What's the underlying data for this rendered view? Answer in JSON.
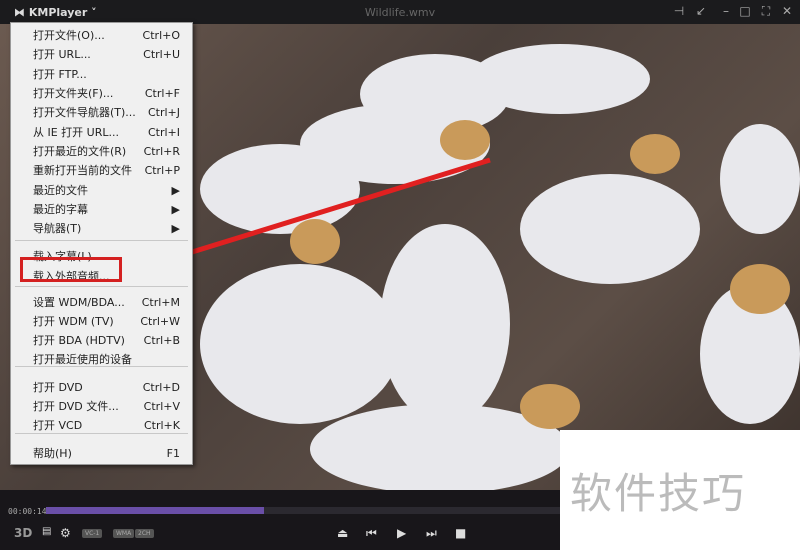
{
  "window": {
    "app": "KMPlayer",
    "title": "Wildlife.wmv",
    "buttons": [
      "pin",
      "shrink",
      "minimize",
      "maximize",
      "fullscreen",
      "close"
    ]
  },
  "menu": {
    "items": [
      {
        "label": "打开文件(O)...",
        "shortcut": "Ctrl+O"
      },
      {
        "label": "打开 URL...",
        "shortcut": "Ctrl+U"
      },
      {
        "label": "打开 FTP...",
        "shortcut": ""
      },
      {
        "label": "打开文件夹(F)...",
        "shortcut": "Ctrl+F"
      },
      {
        "label": "打开文件导航器(T)...",
        "shortcut": "Ctrl+J"
      },
      {
        "label": "从 IE 打开 URL...",
        "shortcut": "Ctrl+I"
      },
      {
        "label": "打开最近的文件(R)",
        "shortcut": "Ctrl+R"
      },
      {
        "label": "重新打开当前的文件",
        "shortcut": "Ctrl+P"
      },
      {
        "label": "最近的文件",
        "shortcut": "▶"
      },
      {
        "label": "最近的字幕",
        "shortcut": "▶"
      },
      {
        "label": "导航器(T)",
        "shortcut": "▶"
      },
      {
        "label": "载入字幕(L)...",
        "shortcut": ""
      },
      {
        "label": "载入外部音频...",
        "shortcut": ""
      },
      {
        "label": "设置 WDM/BDA...",
        "shortcut": "Ctrl+M"
      },
      {
        "label": "打开 WDM (TV)",
        "shortcut": "Ctrl+W"
      },
      {
        "label": "打开 BDA (HDTV)",
        "shortcut": "Ctrl+B"
      },
      {
        "label": "打开最近使用的设备",
        "shortcut": ""
      },
      {
        "label": "打开 DVD",
        "shortcut": "Ctrl+D"
      },
      {
        "label": "打开 DVD 文件...",
        "shortcut": "Ctrl+V"
      },
      {
        "label": "打开 VCD",
        "shortcut": "Ctrl+K"
      },
      {
        "label": "帮助(H)",
        "shortcut": "F1"
      }
    ]
  },
  "controls": {
    "time": "00:00:14",
    "progress_percent": 29,
    "badge_3d": "3D",
    "tags": [
      "VC-1",
      "WMA",
      "2CH"
    ]
  },
  "watermark": "软件技巧",
  "colors": {
    "highlight": "#d42020",
    "progress": "#6a4fa8"
  }
}
